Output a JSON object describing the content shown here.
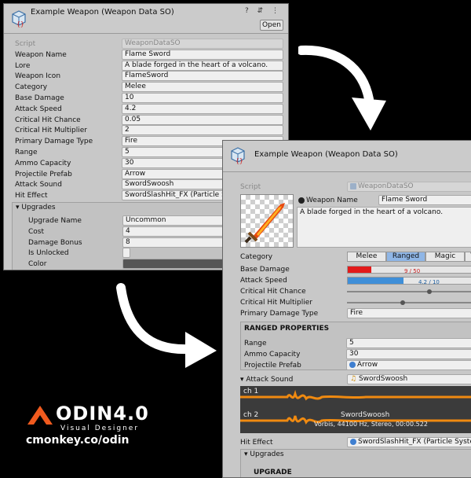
{
  "before_panel": {
    "title": "Example Weapon (Weapon Data SO)",
    "header_icons": "? ⇵ ⋮",
    "open_label": "Open",
    "fields": [
      {
        "label": "Script",
        "value": "WeaponDataSO"
      },
      {
        "label": "Weapon Name",
        "value": "Flame Sword"
      },
      {
        "label": "Lore",
        "value": "A blade forged in the heart of a volcano."
      },
      {
        "label": "Weapon Icon",
        "value": "FlameSword"
      },
      {
        "label": "Category",
        "value": "Melee"
      },
      {
        "label": "Base Damage",
        "value": "10"
      },
      {
        "label": "Attack Speed",
        "value": "4.2"
      },
      {
        "label": "Critical Hit Chance",
        "value": "0.05"
      },
      {
        "label": "Critical Hit Multiplier",
        "value": "2"
      },
      {
        "label": "Primary Damage Type",
        "value": "Fire"
      },
      {
        "label": "Range",
        "value": "5"
      },
      {
        "label": "Ammo Capacity",
        "value": "30"
      },
      {
        "label": "Projectile Prefab",
        "value": "Arrow"
      },
      {
        "label": "Attack Sound",
        "value": "SwordSwoosh"
      },
      {
        "label": "Hit Effect",
        "value": "SwordSlashHit_FX (Particle Sy"
      }
    ],
    "upgrades_label": "Upgrades",
    "upgrade_fields": [
      {
        "label": "Upgrade Name",
        "value": "Uncommon"
      },
      {
        "label": "Cost",
        "value": "4"
      },
      {
        "label": "Damage Bonus",
        "value": "8"
      },
      {
        "label": "Is Unlocked",
        "value": ""
      },
      {
        "label": "Color",
        "value": ""
      }
    ]
  },
  "after_panel": {
    "title": "Example Weapon (Weapon Data SO)",
    "script_label": "Script",
    "script_value": "WeaponDataSO",
    "weapon_name_label": "Weapon Name",
    "weapon_name_value": "Flame Sword",
    "lore_value": "A blade forged in the heart of a volcano.",
    "category_label": "Category",
    "category_options": [
      "Melee",
      "Ranged",
      "Magic"
    ],
    "category_selected": "Ranged",
    "base_damage_label": "Base Damage",
    "base_damage_text": "9 / 50",
    "base_damage_fraction": 0.18,
    "attack_speed_label": "Attack Speed",
    "attack_speed_text": "4.2 / 10",
    "attack_speed_fraction": 0.42,
    "crit_chance_label": "Critical Hit Chance",
    "crit_chance_fraction": 0.6,
    "crit_mult_label": "Critical Hit Multiplier",
    "crit_mult_fraction": 0.4,
    "damage_type_label": "Primary Damage Type",
    "damage_type_value": "Fire",
    "ranged_header": "RANGED PROPERTIES",
    "range_label": "Range",
    "range_value": "5",
    "ammo_label": "Ammo Capacity",
    "ammo_value": "30",
    "projectile_label": "Projectile Prefab",
    "projectile_value": "Arrow",
    "attack_sound_label": "Attack Sound",
    "attack_sound_value": "SwordSwoosh",
    "ch1": "ch 1",
    "ch2": "ch 2",
    "clip_name": "SwordSwoosh",
    "clip_info": "Vorbis, 44100 Hz, Stereo, 00:00.522",
    "hit_effect_label": "Hit Effect",
    "hit_effect_value": "SwordSlashHit_FX (Particle System)",
    "upgrades_label": "Upgrades",
    "upgrade_header": "UPGRADE",
    "colors": {
      "damage_bar": "#e21a1a",
      "speed_bar": "#3f8fd8",
      "waveform": "#f08a10",
      "selected_tab": "#8fb6e6"
    }
  },
  "logo": {
    "brand": "ODIN4.0",
    "subtitle": "Visual Designer",
    "url": "cmonkey.co/odin",
    "accent": "#f05a1e"
  }
}
